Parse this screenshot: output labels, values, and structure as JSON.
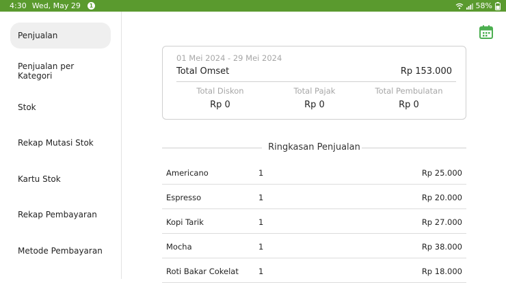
{
  "status_bar": {
    "time": "4:30",
    "date": "Wed, May 29",
    "notification_count": "1",
    "battery": "58%"
  },
  "sidebar": {
    "items": [
      {
        "label": "Penjualan",
        "active": true
      },
      {
        "label": "Penjualan per Kategori",
        "active": false
      },
      {
        "label": "Stok",
        "active": false
      },
      {
        "label": "Rekap Mutasi Stok",
        "active": false
      },
      {
        "label": "Kartu Stok",
        "active": false
      },
      {
        "label": "Rekap Pembayaran",
        "active": false
      },
      {
        "label": "Metode Pembayaran",
        "active": false
      }
    ]
  },
  "summary": {
    "date_range": "01 Mei 2024 - 29 Mei 2024",
    "omset_label": "Total Omset",
    "omset_value": "Rp 153.000",
    "stats": [
      {
        "label": "Total Diskon",
        "value": "Rp 0"
      },
      {
        "label": "Total Pajak",
        "value": "Rp 0"
      },
      {
        "label": "Total Pembulatan",
        "value": "Rp 0"
      }
    ]
  },
  "sales_summary": {
    "title": "Ringkasan Penjualan",
    "rows": [
      {
        "name": "Americano",
        "qty": "1",
        "amount": "Rp 25.000"
      },
      {
        "name": "Espresso",
        "qty": "1",
        "amount": "Rp 20.000"
      },
      {
        "name": "Kopi Tarik",
        "qty": "1",
        "amount": "Rp 27.000"
      },
      {
        "name": "Mocha",
        "qty": "1",
        "amount": "Rp 38.000"
      },
      {
        "name": "Roti Bakar Cokelat",
        "qty": "1",
        "amount": "Rp 18.000"
      }
    ]
  },
  "colors": {
    "status_bar": "#5a9a2e",
    "accent": "#4caf50",
    "active_item_bg": "#efefef",
    "muted_text": "#a6a6a6",
    "divider": "#cfcfcf"
  },
  "icons": {
    "calendar": "calendar-icon",
    "wifi": "wifi-icon",
    "signal": "signal-icon",
    "battery": "battery-icon"
  }
}
